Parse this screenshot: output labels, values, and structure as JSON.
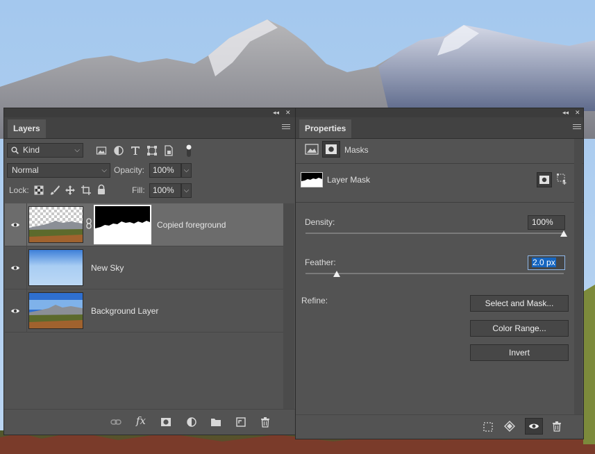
{
  "layers_panel": {
    "tab_label": "Layers",
    "filter_kind": "Kind",
    "blend_mode": "Normal",
    "opacity_label": "Opacity:",
    "opacity_value": "100%",
    "lock_label": "Lock:",
    "fill_label": "Fill:",
    "fill_value": "100%",
    "layers": [
      {
        "name": "Copied foreground",
        "visible": true,
        "selected": true,
        "has_mask": true
      },
      {
        "name": "New Sky",
        "visible": true,
        "selected": false,
        "has_mask": false
      },
      {
        "name": "Background Layer",
        "visible": true,
        "selected": false,
        "has_mask": false
      }
    ]
  },
  "properties_panel": {
    "tab_label": "Properties",
    "section_title": "Masks",
    "mask_label": "Layer Mask",
    "density_label": "Density:",
    "density_value": "100%",
    "density_fraction": 1.0,
    "feather_label": "Feather:",
    "feather_value": "2.0 px",
    "feather_fraction": 0.12,
    "refine_label": "Refine:",
    "buttons": {
      "select_and_mask": "Select and Mask...",
      "color_range": "Color Range...",
      "invert": "Invert"
    }
  },
  "colors": {
    "panel_bg": "#535353",
    "selected_row": "#6c6c6c",
    "sky": "#a9cdf0",
    "field_highlight": "#1565c0"
  }
}
